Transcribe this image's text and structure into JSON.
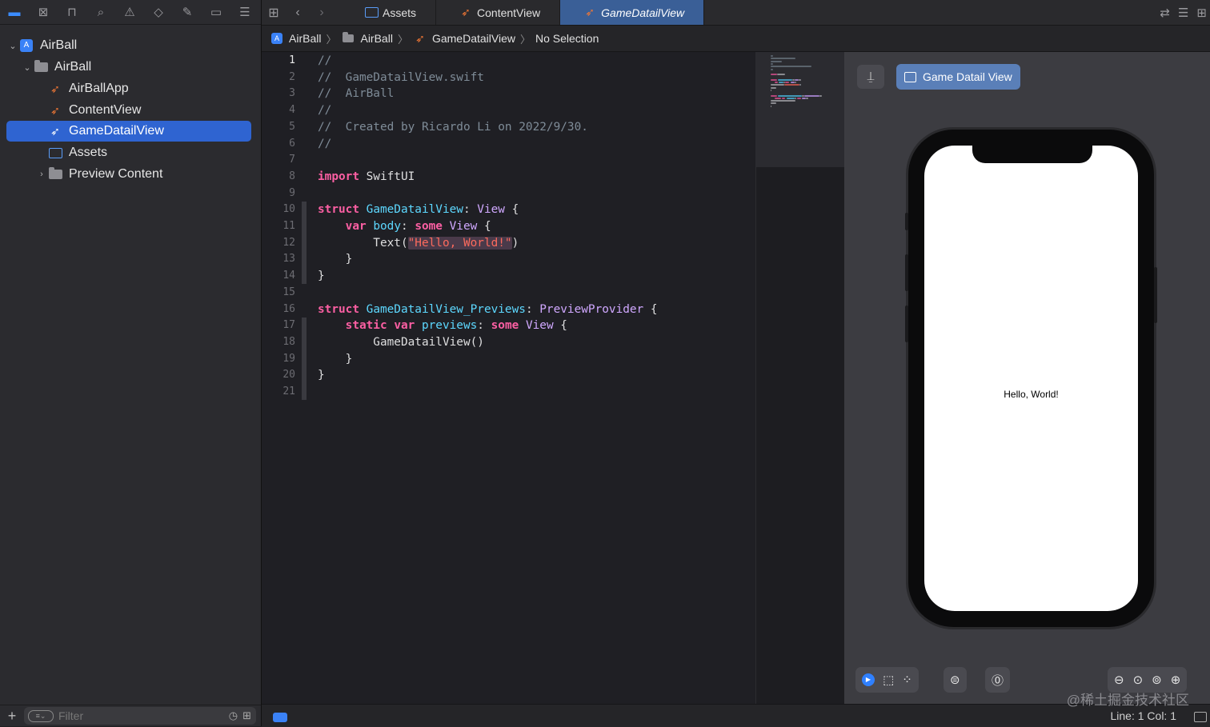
{
  "navigator": {
    "toolbar_icons": [
      "folder-icon",
      "source-control-icon",
      "symbol-icon",
      "search-icon",
      "warning-icon",
      "test-icon",
      "debug-icon",
      "breakpoint-icon",
      "report-icon"
    ],
    "tree": [
      {
        "label": "AirBall",
        "kind": "project",
        "depth": 0,
        "disclosure": "expanded"
      },
      {
        "label": "AirBall",
        "kind": "folder",
        "depth": 1,
        "disclosure": "expanded"
      },
      {
        "label": "AirBallApp",
        "kind": "swift",
        "depth": 2
      },
      {
        "label": "ContentView",
        "kind": "swift",
        "depth": 2
      },
      {
        "label": "GameDatailView",
        "kind": "swift",
        "depth": 2,
        "selected": true
      },
      {
        "label": "Assets",
        "kind": "assets",
        "depth": 2
      },
      {
        "label": "Preview Content",
        "kind": "folder",
        "depth": 2,
        "disclosure": "collapsed"
      }
    ],
    "filter_placeholder": "Filter"
  },
  "tabs": [
    {
      "label": "Assets",
      "icon": "assets-icon"
    },
    {
      "label": "ContentView",
      "icon": "swift-icon"
    },
    {
      "label": "GameDatailView",
      "icon": "swift-icon",
      "active": true
    }
  ],
  "breadcrumb": {
    "project": "AirBall",
    "group": "AirBall",
    "file": "GameDatailView",
    "selection": "No Selection"
  },
  "editor": {
    "current_line": 1,
    "lines": [
      [
        {
          "t": "//",
          "c": "cm"
        }
      ],
      [
        {
          "t": "//  GameDatailView.swift",
          "c": "cm"
        }
      ],
      [
        {
          "t": "//  AirBall",
          "c": "cm"
        }
      ],
      [
        {
          "t": "//",
          "c": "cm"
        }
      ],
      [
        {
          "t": "//  Created by Ricardo Li on 2022/9/30.",
          "c": "cm"
        }
      ],
      [
        {
          "t": "//",
          "c": "cm"
        }
      ],
      [],
      [
        {
          "t": "import",
          "c": "kw"
        },
        {
          "t": " SwiftUI",
          "c": "pl"
        }
      ],
      [],
      [
        {
          "t": "struct",
          "c": "kw"
        },
        {
          "t": " ",
          "c": "pl"
        },
        {
          "t": "GameDatailView",
          "c": "ty"
        },
        {
          "t": ": ",
          "c": "pl"
        },
        {
          "t": "View",
          "c": "tp"
        },
        {
          "t": " {",
          "c": "pl"
        }
      ],
      [
        {
          "t": "    ",
          "c": "pl"
        },
        {
          "t": "var",
          "c": "kw"
        },
        {
          "t": " ",
          "c": "pl"
        },
        {
          "t": "body",
          "c": "ty"
        },
        {
          "t": ": ",
          "c": "pl"
        },
        {
          "t": "some",
          "c": "kw"
        },
        {
          "t": " ",
          "c": "pl"
        },
        {
          "t": "View",
          "c": "tp"
        },
        {
          "t": " {",
          "c": "pl"
        }
      ],
      [
        {
          "t": "        Text(",
          "c": "pl"
        },
        {
          "t": "\"Hello, World!\"",
          "c": "st"
        },
        {
          "t": ")",
          "c": "pl"
        }
      ],
      [
        {
          "t": "    }",
          "c": "pl"
        }
      ],
      [
        {
          "t": "}",
          "c": "pl"
        }
      ],
      [],
      [
        {
          "t": "struct",
          "c": "kw"
        },
        {
          "t": " ",
          "c": "pl"
        },
        {
          "t": "GameDatailView_Previews",
          "c": "ty"
        },
        {
          "t": ": ",
          "c": "pl"
        },
        {
          "t": "PreviewProvider",
          "c": "tp"
        },
        {
          "t": " {",
          "c": "pl"
        }
      ],
      [
        {
          "t": "    ",
          "c": "pl"
        },
        {
          "t": "static",
          "c": "kw"
        },
        {
          "t": " ",
          "c": "pl"
        },
        {
          "t": "var",
          "c": "kw"
        },
        {
          "t": " ",
          "c": "pl"
        },
        {
          "t": "previews",
          "c": "ty"
        },
        {
          "t": ": ",
          "c": "pl"
        },
        {
          "t": "some",
          "c": "kw"
        },
        {
          "t": " ",
          "c": "pl"
        },
        {
          "t": "View",
          "c": "tp"
        },
        {
          "t": " {",
          "c": "pl"
        }
      ],
      [
        {
          "t": "        GameDatailView()",
          "c": "pl"
        }
      ],
      [
        {
          "t": "    }",
          "c": "pl"
        }
      ],
      [
        {
          "t": "}",
          "c": "pl"
        }
      ],
      []
    ]
  },
  "canvas": {
    "preview_label": "Game Datail View",
    "preview_text": "Hello, World!",
    "bottom_left_icons": [
      "live-preview-icon",
      "selectable-icon",
      "variants-icon"
    ],
    "device_settings_icon": "device-settings-icon",
    "run_icon": "run-on-device-icon",
    "zoom_icons": [
      "zoom-out-icon",
      "zoom-fit-icon",
      "zoom-actual-icon",
      "zoom-in-icon"
    ]
  },
  "status": {
    "line_col": "Line: 1  Col: 1",
    "watermark": "@稀土掘金技术社区"
  },
  "colors": {
    "accent": "#2f64d1",
    "active_tab": "#3a5f97",
    "keyword": "#fc5fa3",
    "type": "#5dd8ff",
    "string": "#fc6a5d",
    "comment": "#7f8c98"
  }
}
